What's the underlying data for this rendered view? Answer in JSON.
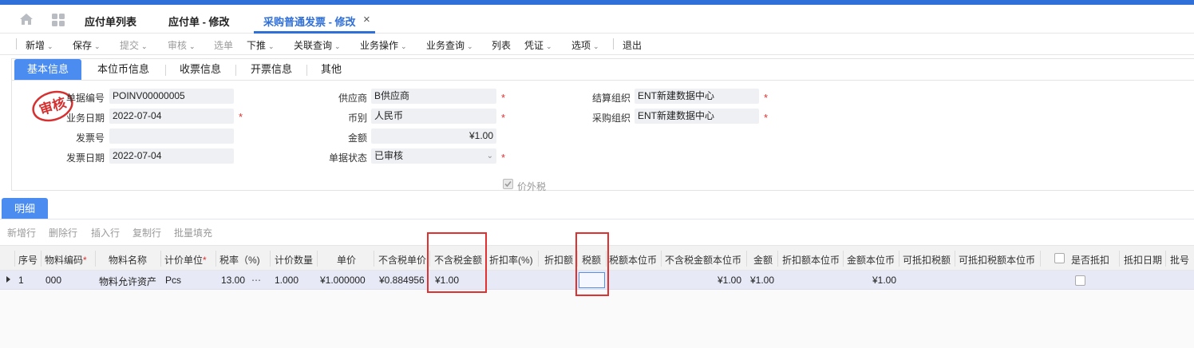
{
  "tabs": {
    "items": [
      "应付单列表",
      "应付单 - 修改",
      "采购普通发票 - 修改"
    ],
    "close": "×"
  },
  "toolbar": {
    "new": "新增",
    "save": "保存",
    "submit": "提交",
    "audit": "审核",
    "select": "选单",
    "push": "下推",
    "related_query": "关联查询",
    "biz_op": "业务操作",
    "biz_query": "业务查询",
    "list": "列表",
    "voucher": "凭证",
    "options": "选项",
    "exit": "退出"
  },
  "subtabs": [
    "基本信息",
    "本位币信息",
    "收票信息",
    "开票信息",
    "其他"
  ],
  "stamp": "审核",
  "form": {
    "doc_no_label": "单据编号",
    "doc_no": "POINV00000005",
    "biz_date_label": "业务日期",
    "biz_date": "2022-07-04",
    "invoice_no_label": "发票号",
    "invoice_no": "",
    "invoice_date_label": "发票日期",
    "invoice_date": "2022-07-04",
    "supplier_label": "供应商",
    "supplier": "B供应商",
    "currency_label": "币别",
    "currency": "人民币",
    "amount_label": "金额",
    "amount": "¥1.00",
    "status_label": "单据状态",
    "status": "已审核",
    "settle_org_label": "结算组织",
    "settle_org": "ENT新建数据中心",
    "purchase_org_label": "采购组织",
    "purchase_org": "ENT新建数据中心",
    "tax_excluded_label": "价外税",
    "required_mark": "*"
  },
  "detail": {
    "tab": "明细",
    "toolbar": [
      "新增行",
      "删除行",
      "插入行",
      "复制行",
      "批量填充"
    ],
    "columns": [
      "序号",
      "物料编码",
      "物料名称",
      "计价单位",
      "税率（%)",
      "计价数量",
      "单价",
      "不含税单价",
      "不含税金额",
      "折扣率(%)",
      "折扣额",
      "税额",
      "税额本位币",
      "不含税金额本位币",
      "金额",
      "折扣额本位币",
      "金额本位币",
      "可抵扣税额",
      "可抵扣税额本位币",
      "是否抵扣",
      "抵扣日期",
      "批号"
    ],
    "row": {
      "seq": "1",
      "material_code": "000",
      "material_name": "物料允许资产",
      "unit": "Pcs",
      "tax_rate": "13.00",
      "tax_rate_more": "⋯",
      "qty": "1.000",
      "price": "¥1.000000",
      "price_ex_tax": "¥0.884956",
      "amount_ex_tax": "¥1.00",
      "discount_rate": "",
      "discount_amt": "",
      "tax": "",
      "tax_local": "",
      "amount_ex_tax_local": "¥1.00",
      "amount": "¥1.00",
      "discount_local": "",
      "amount_local": "¥1.00",
      "deductible_tax": "",
      "deductible_tax_local": ""
    }
  },
  "colors": {
    "accent": "#2f6fd8",
    "tab_active_bg": "#4a8cf0",
    "required": "#e03030",
    "highlight_box": "#e03030"
  }
}
